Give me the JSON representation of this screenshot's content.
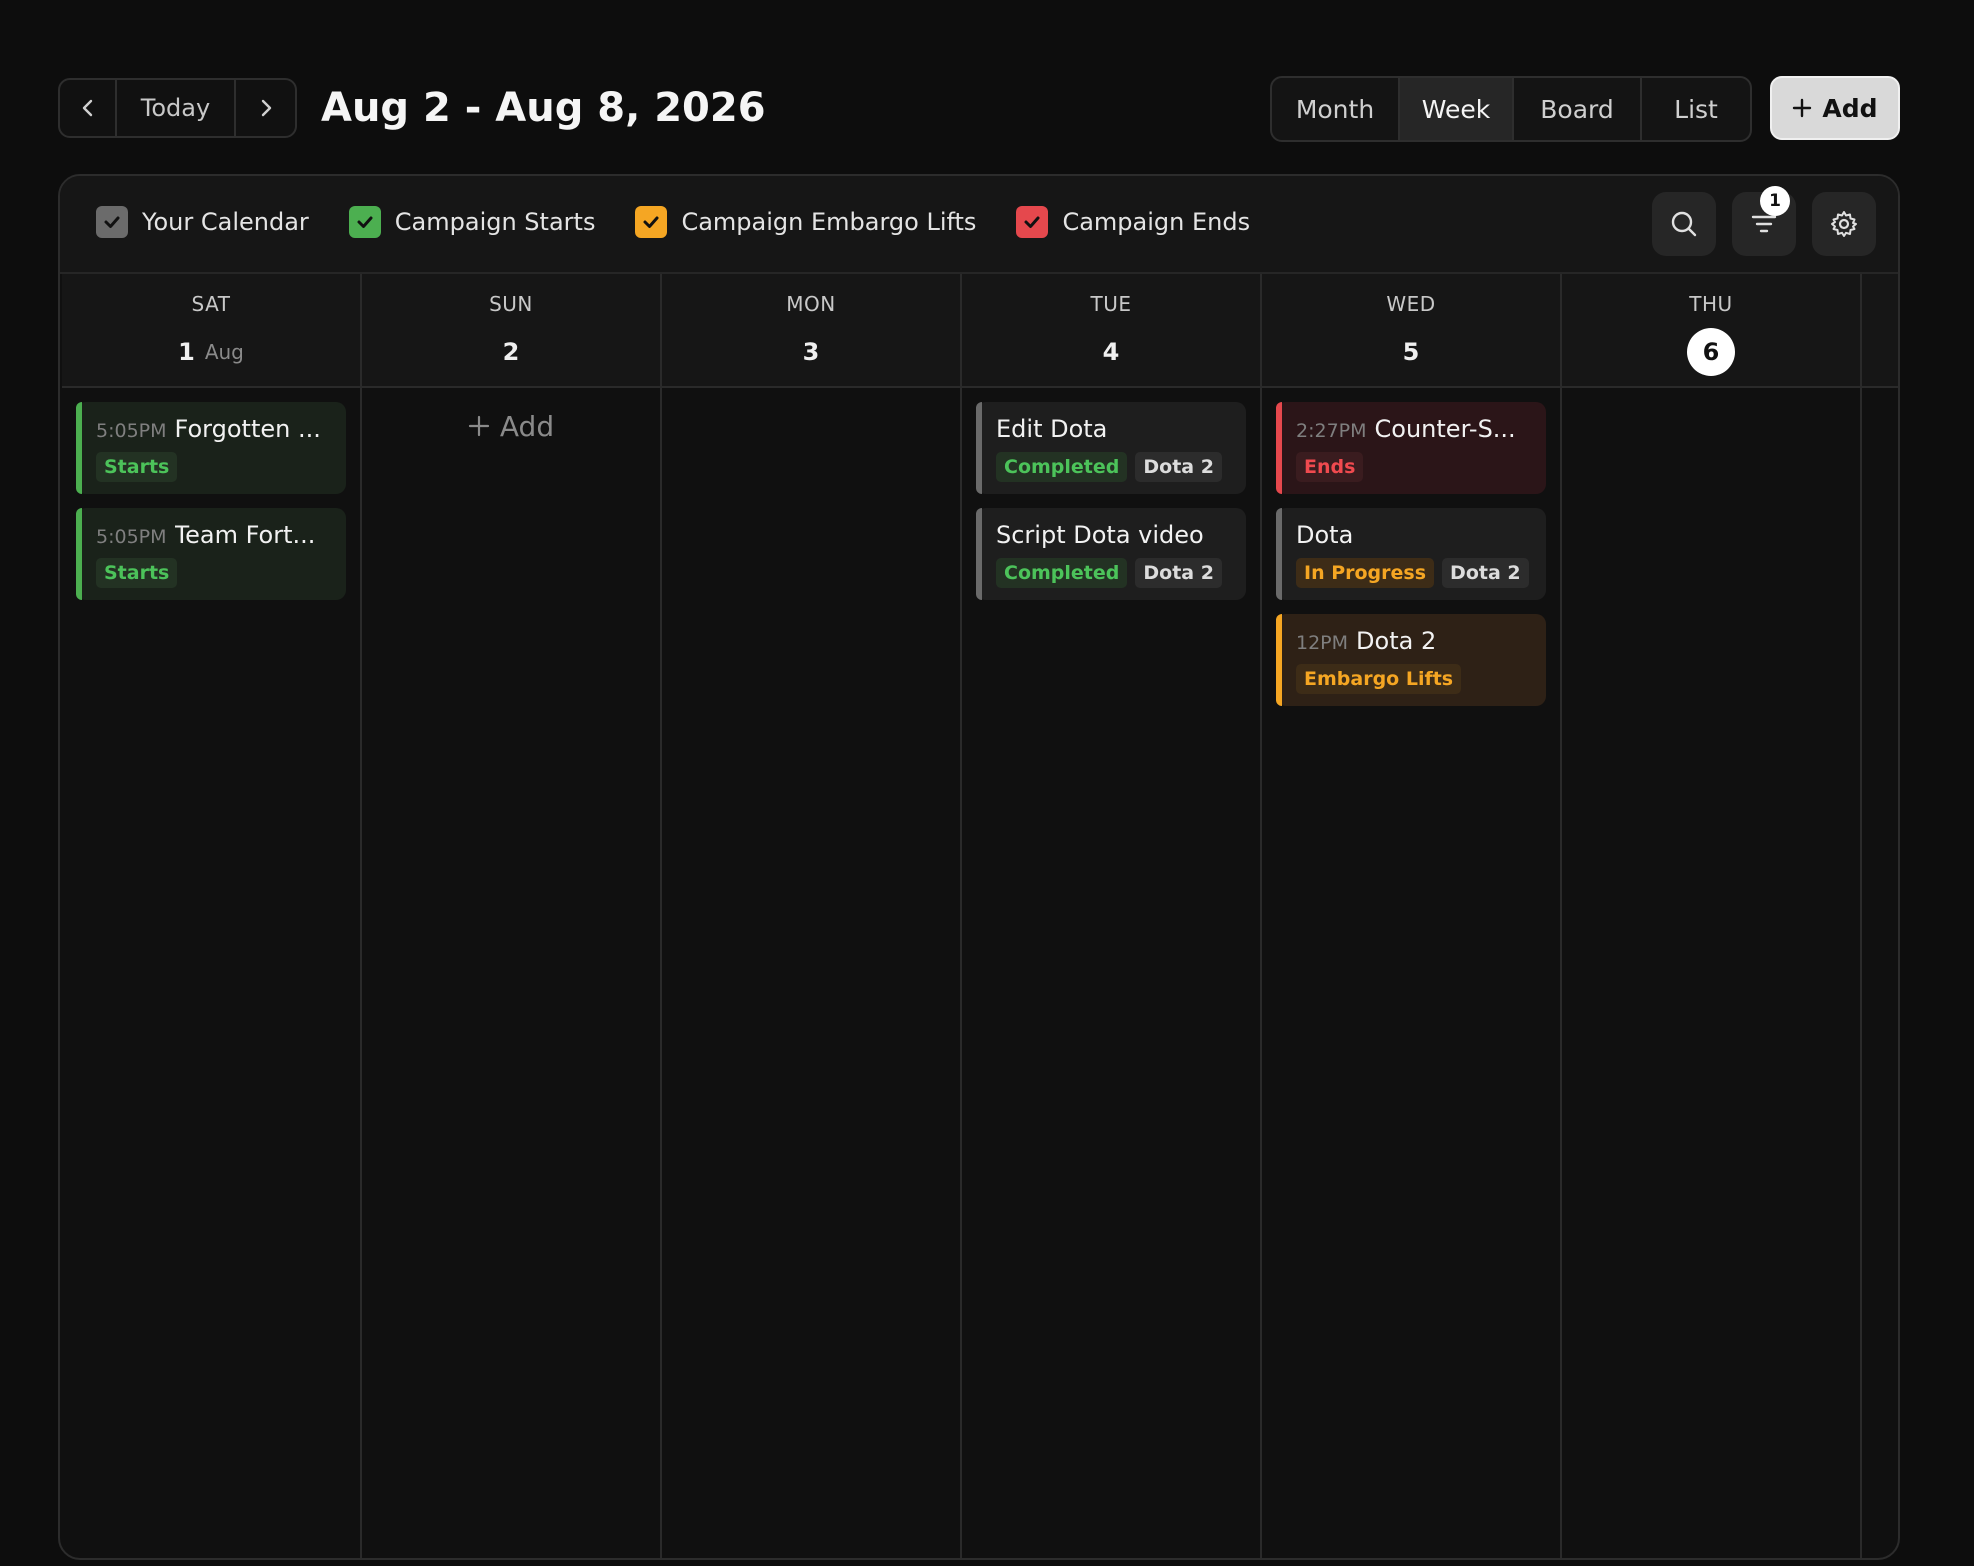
{
  "header": {
    "today_label": "Today",
    "title": "Aug 2 - Aug 8, 2026",
    "views": [
      "Month",
      "Week",
      "Board",
      "List"
    ],
    "active_view": "Week",
    "add_label": "Add"
  },
  "toolbar": {
    "calendars": [
      {
        "label": "Your Calendar",
        "color": "#6b6b6b",
        "checked": true
      },
      {
        "label": "Campaign Starts",
        "color": "#4caf50",
        "checked": true
      },
      {
        "label": "Campaign Embargo Lifts",
        "color": "#f5a623",
        "checked": true
      },
      {
        "label": "Campaign Ends",
        "color": "#e5484d",
        "checked": true
      }
    ],
    "filter_count": "1",
    "icons": [
      "search-icon",
      "filter-icon",
      "gear-icon"
    ]
  },
  "days": [
    {
      "dow": "SAT",
      "num": "1",
      "month": "Aug"
    },
    {
      "dow": "SUN",
      "num": "2",
      "month": ""
    },
    {
      "dow": "MON",
      "num": "3",
      "month": ""
    },
    {
      "dow": "TUE",
      "num": "4",
      "month": ""
    },
    {
      "dow": "WED",
      "num": "5",
      "month": ""
    },
    {
      "dow": "THU",
      "num": "6",
      "month": "",
      "today": true
    }
  ],
  "events": {
    "sat": [
      {
        "time": "5:05PM",
        "title": "Forgotten ...",
        "tags": [
          "Starts"
        ]
      },
      {
        "time": "5:05PM",
        "title": "Team Fort...",
        "tags": [
          "Starts"
        ]
      }
    ],
    "sun_add_label": "Add",
    "tue": [
      {
        "title": "Edit Dota",
        "tags": [
          "Completed",
          "Dota 2"
        ]
      },
      {
        "title": "Script Dota video",
        "tags": [
          "Completed",
          "Dota 2"
        ]
      }
    ],
    "wed": [
      {
        "time": "2:27PM",
        "title": "Counter-S...",
        "tags": [
          "Ends"
        ]
      },
      {
        "title": "Dota",
        "tags": [
          "In Progress",
          "Dota 2"
        ]
      },
      {
        "time": "12PM",
        "title": "Dota 2",
        "tags": [
          "Embargo Lifts"
        ]
      }
    ]
  }
}
